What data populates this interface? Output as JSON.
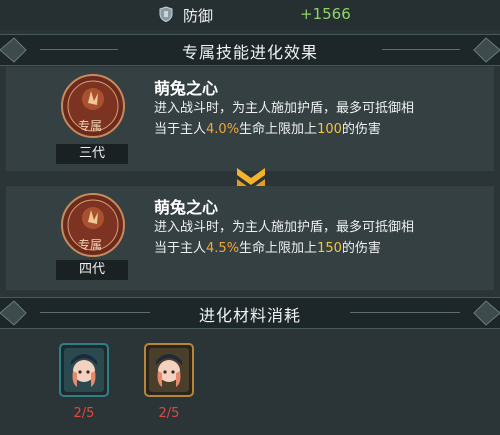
{
  "stat": {
    "icon": "shield-icon",
    "label": "防御",
    "value": "+1566"
  },
  "effects_header": {
    "title": "专属技能进化效果"
  },
  "skills": [
    {
      "name": "萌兔之心",
      "tier": "三代",
      "badge": "专属",
      "icon": "rabbit-paw-emblem-icon",
      "desc_line1": "进入战斗时，为主人施加护盾，最多可抵御相",
      "desc_line2_a": "当于主人",
      "desc_line2_pct": "4.0%",
      "desc_line2_b": "生命上限加上",
      "desc_line2_num": "100",
      "desc_line2_c": "的伤害"
    },
    {
      "name": "萌兔之心",
      "tier": "四代",
      "badge": "专属",
      "icon": "rabbit-paw-emblem-icon",
      "desc_line1": "进入战斗时，为主人施加护盾，最多可抵御相",
      "desc_line2_a": "当于主人",
      "desc_line2_pct": "4.5%",
      "desc_line2_b": "生命上限加上",
      "desc_line2_num": "150",
      "desc_line2_c": "的伤害"
    }
  ],
  "arrow_icon": "double-chevron-down-icon",
  "materials_header": {
    "title": "进化材料消耗"
  },
  "materials": [
    {
      "icon": "character-portrait-icon",
      "count": "2/5",
      "frame_color": "#2f7f86"
    },
    {
      "icon": "character-portrait-icon",
      "count": "2/5",
      "frame_color": "#b8863a"
    }
  ],
  "colors": {
    "stat_value": "#8fd36a",
    "highlight_pct": "#f3a63c",
    "highlight_num": "#f3c63c",
    "count_red": "#e0483e"
  }
}
